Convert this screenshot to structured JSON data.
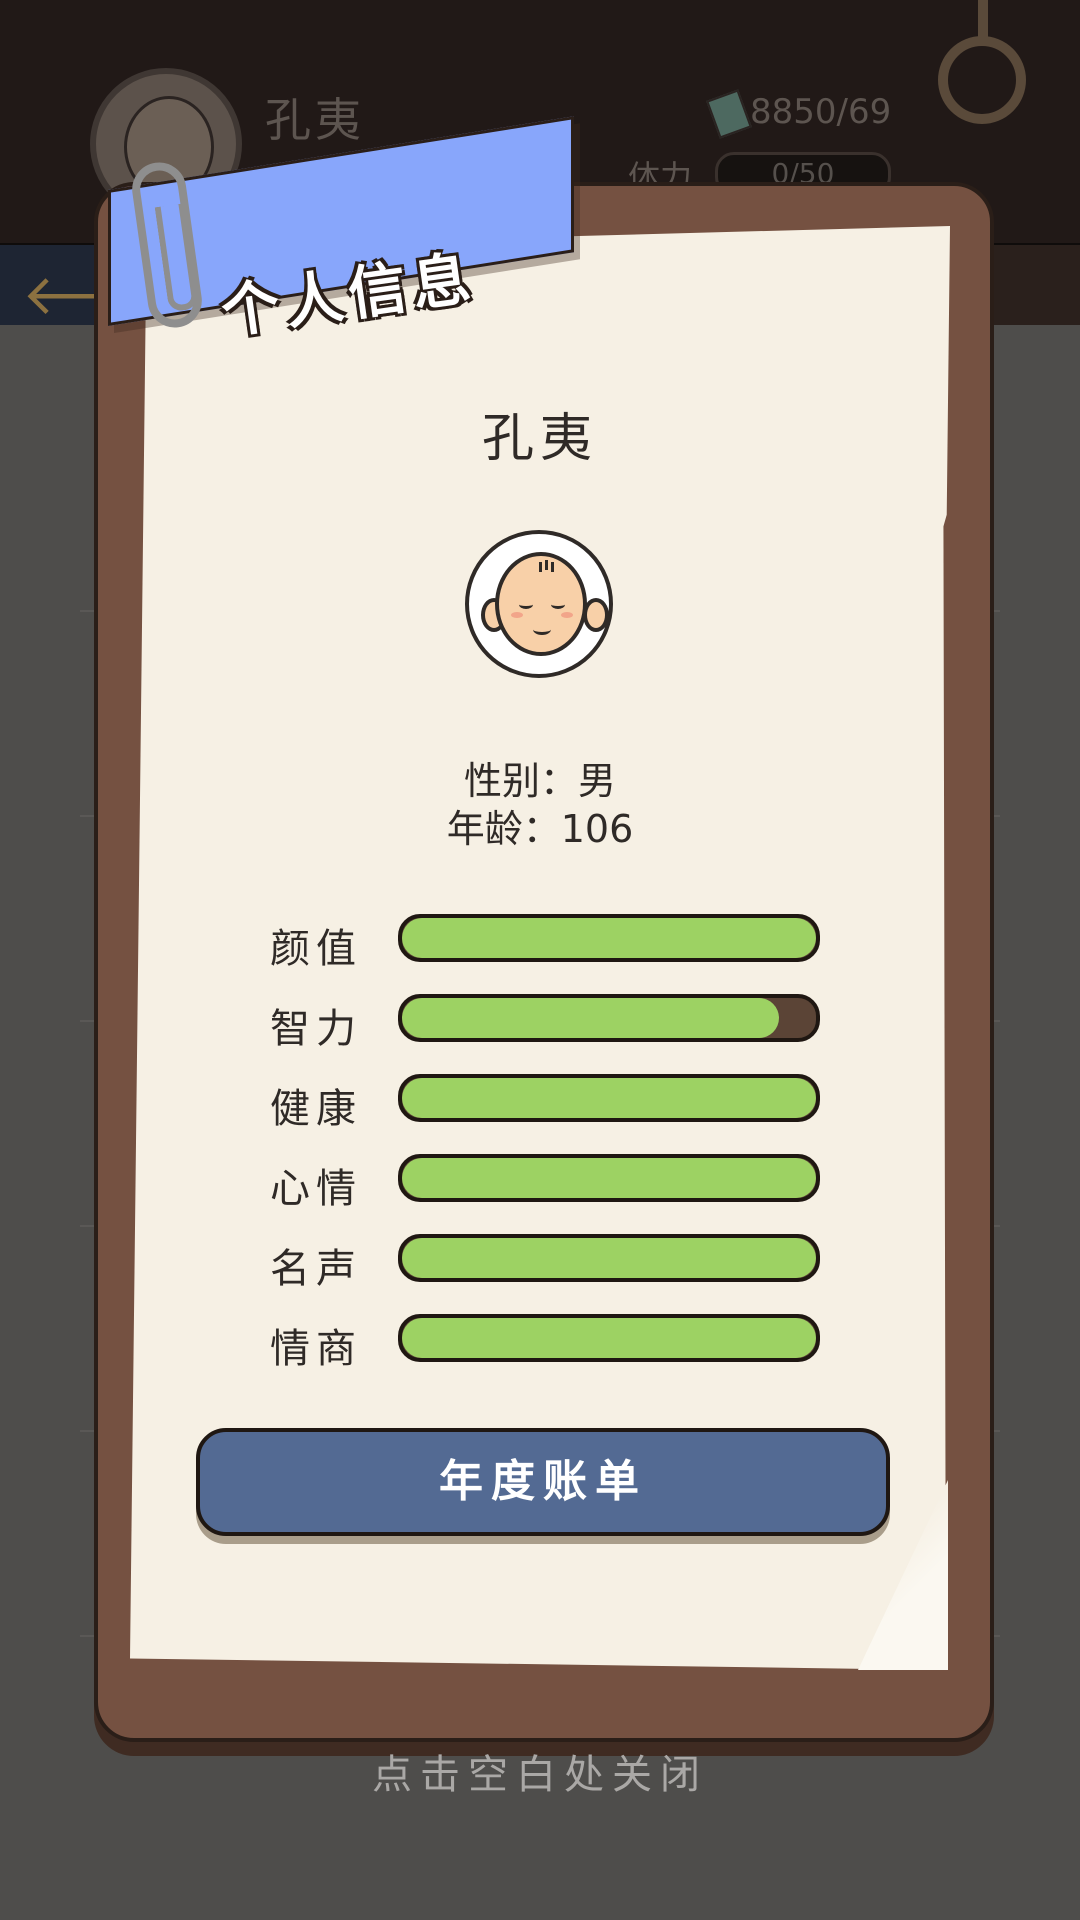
{
  "background": {
    "player_name": "孔夷",
    "currency": "8850/69",
    "stamina_label": "体力",
    "stamina_value": "0/50"
  },
  "panel": {
    "title": "个人信息",
    "character_name": "孔夷",
    "gender": "性别：男",
    "age": "年龄：106",
    "stats": [
      {
        "label": "颜值",
        "value": 1.0
      },
      {
        "label": "智力",
        "value": 0.91
      },
      {
        "label": "健康",
        "value": 1.0
      },
      {
        "label": "心情",
        "value": 1.0
      },
      {
        "label": "名声",
        "value": 1.0
      },
      {
        "label": "情商",
        "value": 1.0
      }
    ],
    "annual_bill_button": "年度账单"
  },
  "close_hint": "点击空白处关闭",
  "colors": {
    "stat_fill": "#9dd263",
    "ribbon": "#88a6fb",
    "button": "#536a93",
    "board": "#755141",
    "paper": "#f6f0e4"
  }
}
